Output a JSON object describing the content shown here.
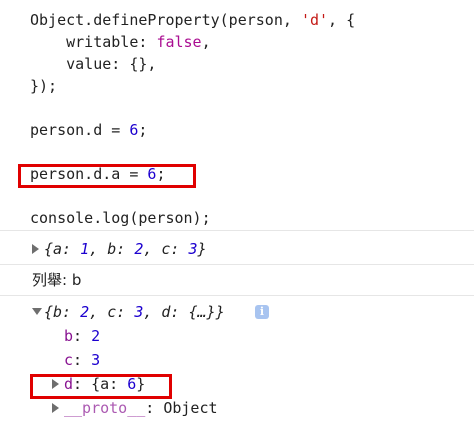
{
  "code": {
    "line1_a": "Object.defineProperty(person, ",
    "line1_str": "'d'",
    "line1_b": ", {",
    "line2_key": "    writable: ",
    "line2_val": "false",
    "line2_end": ",",
    "line3": "    value: {},",
    "line4": "});",
    "line5_a": "person.d = ",
    "line5_num": "6",
    "line5_end": ";",
    "line6_a": "person.d.a = ",
    "line6_num": "6",
    "line6_end": ";",
    "line7": "console.log(person);"
  },
  "console": {
    "result1": {
      "open": "{a: ",
      "v1": "1",
      "s1": ", b: ",
      "v2": "2",
      "s2": ", c: ",
      "v3": "3",
      "close": "}"
    },
    "enum_label": "列舉: b",
    "result2": {
      "open": "{b: ",
      "v1": "2",
      "s1": ", c: ",
      "v2": "3",
      "s2": ", d: {…}}",
      "info_glyph": "i"
    },
    "props": [
      {
        "key": "b",
        "sep": ": ",
        "value": "2"
      },
      {
        "key": "c",
        "sep": ": ",
        "value": "3"
      }
    ],
    "prop_d": {
      "key": "d",
      "sep": ": {a: ",
      "num": "6",
      "close": "}"
    },
    "proto": {
      "key": "__proto__",
      "sep": ": ",
      "value": "Object"
    }
  },
  "colors": {
    "highlight_box": "#e00000",
    "string": "#c41a16",
    "keyword": "#aa0d91",
    "number": "#1c00cf",
    "property": "#881391"
  }
}
